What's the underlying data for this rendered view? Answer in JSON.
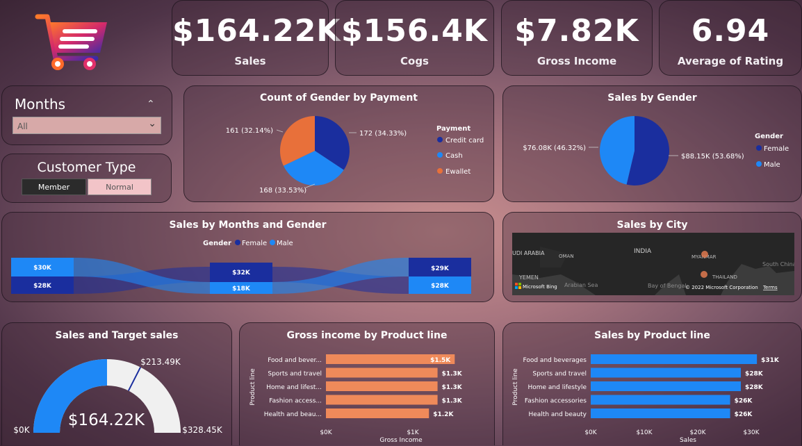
{
  "kpis": [
    {
      "value": "$164.22K",
      "label": "Sales"
    },
    {
      "value": "$156.4K",
      "label": "Cogs"
    },
    {
      "value": "$7.82K",
      "label": "Gross Income"
    },
    {
      "value": "6.94",
      "label": "Average of Rating"
    }
  ],
  "filters": {
    "months_title": "Months",
    "months_value": "All",
    "customer_type_title": "Customer Type",
    "customer_type_options": [
      "Member",
      "Normal"
    ]
  },
  "colors": {
    "dark_blue": "#1a2e9e",
    "blue": "#1e88f6",
    "orange": "#e8703a",
    "bar_orange": "#ef8a5a",
    "accent": "#c42a6a"
  },
  "payment_chart": {
    "title": "Count of Gender by Payment",
    "legend_title": "Payment",
    "legend": [
      "Credit card",
      "Cash",
      "Ewallet"
    ],
    "labels": [
      "172 (34.33%)",
      "168 (33.53%)",
      "161 (32.14%)"
    ],
    "chart_data": {
      "type": "pie",
      "categories": [
        "Credit card",
        "Cash",
        "Ewallet"
      ],
      "values": [
        172,
        168,
        161
      ]
    }
  },
  "gender_chart": {
    "title": "Sales by Gender",
    "legend_title": "Gender",
    "legend": [
      "Female",
      "Male"
    ],
    "labels": [
      "$88.15K (53.68%)",
      "$76.08K (46.32%)"
    ],
    "chart_data": {
      "type": "pie",
      "categories": [
        "Female",
        "Male"
      ],
      "values": [
        88.15,
        76.08
      ]
    }
  },
  "months_chart": {
    "title": "Sales by Months and Gender",
    "legend_title": "Gender",
    "legend": [
      "Female",
      "Male"
    ],
    "columns": [
      {
        "top": "$30K",
        "bottom": "$28K"
      },
      {
        "top": "$32K",
        "bottom": "$18K"
      },
      {
        "top": "$29K",
        "bottom": "$28K"
      }
    ]
  },
  "city_map": {
    "title": "Sales by City",
    "places": [
      "INDIA",
      "UDI ARABIA",
      "OMAN",
      "YEMEN",
      "MYANMAR",
      "THAILAND",
      "Arabian Sea",
      "Bay of Bengal",
      "South China Sea"
    ],
    "attribution": "Microsoft Bing",
    "copyright": "© 2022 Microsoft Corporation",
    "terms": "Terms"
  },
  "gauge": {
    "title": "Sales and Target sales",
    "value_label": "$164.22K",
    "min_label": "$0K",
    "max_label": "$328.45K",
    "target_label": "$213.49K",
    "chart_data": {
      "type": "gauge",
      "value": 164.22,
      "target": 213.49,
      "min": 0,
      "max": 328.45
    }
  },
  "gross_income_chart": {
    "title": "Gross income by Product line",
    "ylabel": "Product line",
    "xlabel": "Gross Income",
    "ticks": [
      "$0K",
      "$1K"
    ],
    "categories": [
      "Food and bever...",
      "Sports and travel",
      "Home and lifest...",
      "Fashion access...",
      "Health and beau..."
    ],
    "value_labels": [
      "$1.5K",
      "$1.3K",
      "$1.3K",
      "$1.3K",
      "$1.2K"
    ],
    "chart_data": {
      "type": "bar",
      "categories": [
        "Food and beverages",
        "Sports and travel",
        "Home and lifestyle",
        "Fashion accessories",
        "Health and beauty"
      ],
      "values": [
        1.5,
        1.3,
        1.3,
        1.3,
        1.2
      ],
      "xlim": [
        0,
        1.7
      ]
    }
  },
  "sales_product_chart": {
    "title": "Sales by Product line",
    "ylabel": "Product line",
    "xlabel": "Sales",
    "ticks": [
      "$0K",
      "$10K",
      "$20K",
      "$30K"
    ],
    "categories": [
      "Food and beverages",
      "Sports and travel",
      "Home and lifestyle",
      "Fashion accessories",
      "Health and beauty"
    ],
    "value_labels": [
      "$31K",
      "$28K",
      "$28K",
      "$26K",
      "$26K"
    ],
    "chart_data": {
      "type": "bar",
      "categories": [
        "Food and beverages",
        "Sports and travel",
        "Home and lifestyle",
        "Fashion accessories",
        "Health and beauty"
      ],
      "values": [
        31,
        28,
        28,
        26,
        26
      ],
      "xlim": [
        0,
        31.5
      ]
    }
  }
}
